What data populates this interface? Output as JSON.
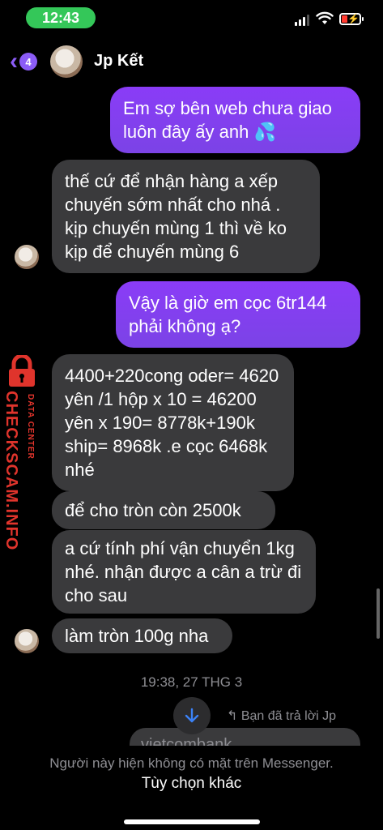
{
  "status_bar": {
    "time": "12:43"
  },
  "header": {
    "back_badge": "4",
    "name": "Jp Kết"
  },
  "messages": [
    {
      "from": "me",
      "text": "Em sợ bên web chưa giao luôn đây ấy anh 💦"
    },
    {
      "from": "them",
      "text": "thế cứ để nhận hàng a xếp chuyến sớm nhất cho nhá . kịp chuyến mùng 1 thì về ko kịp để chuyến mùng 6"
    },
    {
      "from": "me",
      "text": "Vậy là giờ em cọc 6tr144 phải không ạ?"
    },
    {
      "from": "them",
      "text": "4400+220cong oder= 4620 yên /1 hộp    x 10 = 46200 yên  x 190= 8778k+190k ship= 8968k .e cọc 6468k nhé"
    },
    {
      "from": "them",
      "text": "để cho tròn còn 2500k"
    },
    {
      "from": "them",
      "text": "a cứ tính phí vận chuyển 1kg nhé. nhận được a cân a trừ đi cho sau"
    },
    {
      "from": "them",
      "text": "làm tròn 100g nha"
    }
  ],
  "timestamp": "19:38, 27 THG 3",
  "reply_note": "Bạn đã trả lời Jp",
  "partial_message": "vietcombank",
  "footer": {
    "notice": "Người này hiện không có mặt trên Messenger.",
    "option": "Tùy chọn khác"
  },
  "watermark": {
    "main": "CHECKSCAM.INFO",
    "sub": "DATA CENTER"
  },
  "colors": {
    "outgoing": "#8a3cf7",
    "incoming": "#3a3a3c",
    "accent": "#8b5cf6",
    "watermark": "#e0342c"
  },
  "icons": [
    "back-chevron-icon",
    "wifi-icon",
    "battery-charging-icon",
    "arrow-down-icon",
    "reply-icon",
    "lock-icon"
  ]
}
